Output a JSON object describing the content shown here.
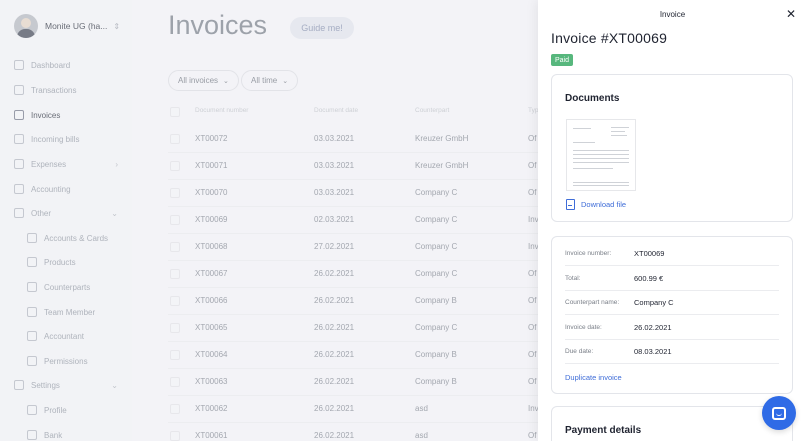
{
  "sidebar": {
    "org_name": "Monite UG (ha...",
    "items": [
      {
        "label": "Dashboard",
        "icon": "dashboard-icon",
        "active": false
      },
      {
        "label": "Transactions",
        "icon": "transactions-icon",
        "active": false
      },
      {
        "label": "Invoices",
        "icon": "invoices-icon",
        "active": true
      },
      {
        "label": "Incoming bills",
        "icon": "incoming-bills-icon",
        "active": false
      },
      {
        "label": "Expenses",
        "icon": "expenses-icon",
        "active": false
      },
      {
        "label": "Accounting",
        "icon": "accounting-icon",
        "active": false
      },
      {
        "label": "Other",
        "icon": "other-icon",
        "active": false
      },
      {
        "label": "Accounts & Cards",
        "icon": "accounts-cards-icon",
        "active": false
      },
      {
        "label": "Products",
        "icon": "products-icon",
        "active": false
      },
      {
        "label": "Counterparts",
        "icon": "counterparts-icon",
        "active": false
      },
      {
        "label": "Team Member",
        "icon": "team-member-icon",
        "active": false
      },
      {
        "label": "Accountant",
        "icon": "accountant-icon",
        "active": false
      },
      {
        "label": "Permissions",
        "icon": "permissions-icon",
        "active": false
      },
      {
        "label": "Settings",
        "icon": "settings-icon",
        "active": false
      },
      {
        "label": "Profile",
        "icon": "profile-icon",
        "active": false
      },
      {
        "label": "Bank",
        "icon": "bank-icon",
        "active": false
      }
    ]
  },
  "main": {
    "title": "Invoices",
    "guide_label": "Guide me!",
    "filters": [
      "All invoices",
      "All time"
    ],
    "columns": [
      "Document number",
      "Document date",
      "Counterpart",
      "Type"
    ],
    "rows": [
      {
        "number": "XT00072",
        "date": "03.03.2021",
        "counterpart": "Kreuzer GmbH",
        "type": "Of"
      },
      {
        "number": "XT00071",
        "date": "03.03.2021",
        "counterpart": "Kreuzer GmbH",
        "type": "Of"
      },
      {
        "number": "XT00070",
        "date": "03.03.2021",
        "counterpart": "Company C",
        "type": "Of"
      },
      {
        "number": "XT00069",
        "date": "02.03.2021",
        "counterpart": "Company C",
        "type": "Inv"
      },
      {
        "number": "XT00068",
        "date": "27.02.2021",
        "counterpart": "Company C",
        "type": "Inv"
      },
      {
        "number": "XT00067",
        "date": "26.02.2021",
        "counterpart": "Company C",
        "type": "Of"
      },
      {
        "number": "XT00066",
        "date": "26.02.2021",
        "counterpart": "Company B",
        "type": "Of"
      },
      {
        "number": "XT00065",
        "date": "26.02.2021",
        "counterpart": "Company C",
        "type": "Of"
      },
      {
        "number": "XT00064",
        "date": "26.02.2021",
        "counterpart": "Company B",
        "type": "Of"
      },
      {
        "number": "XT00063",
        "date": "26.02.2021",
        "counterpart": "Company B",
        "type": "Of"
      },
      {
        "number": "XT00062",
        "date": "26.02.2021",
        "counterpart": "asd",
        "type": "Inv"
      },
      {
        "number": "XT00061",
        "date": "26.02.2021",
        "counterpart": "asd",
        "type": "Of"
      }
    ]
  },
  "panel": {
    "header": "Invoice",
    "title": "Invoice #XT00069",
    "status": "Paid",
    "documents_title": "Documents",
    "download_label": "Download file",
    "details": [
      {
        "label": "Invoice number:",
        "value": "XT00069"
      },
      {
        "label": "Total:",
        "value": "600.99 €"
      },
      {
        "label": "Counterpart name:",
        "value": "Company C"
      },
      {
        "label": "Invoice date:",
        "value": "26.02.2021"
      },
      {
        "label": "Due date:",
        "value": "08.03.2021"
      }
    ],
    "duplicate_label": "Duplicate invoice",
    "payment_title": "Payment details"
  },
  "colors": {
    "accent": "#3f6dd8",
    "paid": "#57b77d",
    "chat": "#2f6be6"
  }
}
